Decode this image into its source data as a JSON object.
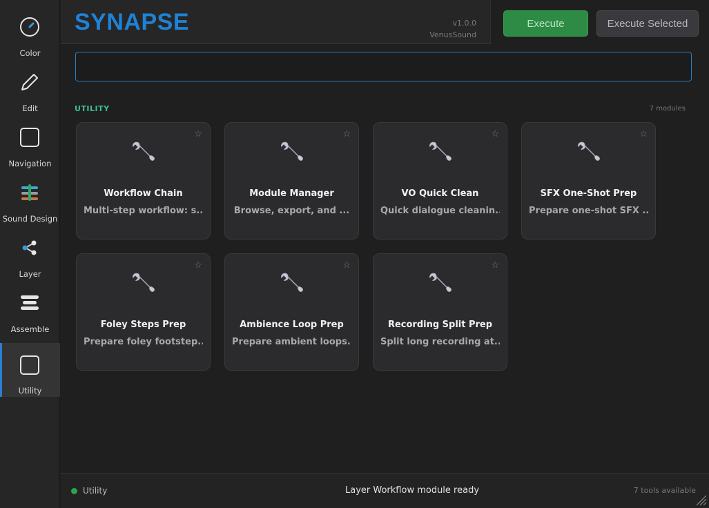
{
  "sidebar": {
    "items": [
      {
        "label": "Color",
        "icon": "gauge-icon"
      },
      {
        "label": "Edit",
        "icon": "pencil-icon"
      },
      {
        "label": "Navigation",
        "icon": "square-icon"
      },
      {
        "label": "Sound Design",
        "icon": "sliders-icon"
      },
      {
        "label": "Layer",
        "icon": "share-icon"
      },
      {
        "label": "Assemble",
        "icon": "stack-icon"
      },
      {
        "label": "Utility",
        "icon": "square-icon",
        "active": true
      }
    ]
  },
  "header": {
    "brand": "SYNAPSE",
    "version": "v1.0.0",
    "vendor": "VenusSound"
  },
  "toolbar": {
    "execute_label": "Execute",
    "execute_selected_label": "Execute Selected"
  },
  "search": {
    "value": "",
    "placeholder": ""
  },
  "section": {
    "title": "UTILITY",
    "count": "7 modules"
  },
  "modules": [
    {
      "name": "Workflow Chain",
      "desc": "Multi-step workflow: s...",
      "icon": "wrench-icon",
      "favorite_icon": "star-icon"
    },
    {
      "name": "Module Manager",
      "desc": "Browse, export, and ...",
      "icon": "wrench-icon",
      "favorite_icon": "star-icon"
    },
    {
      "name": "VO Quick Clean",
      "desc": "Quick dialogue cleanin...",
      "icon": "wrench-icon",
      "favorite_icon": "star-icon"
    },
    {
      "name": "SFX One-Shot Prep",
      "desc": "Prepare one-shot SFX ...",
      "icon": "wrench-icon",
      "favorite_icon": "star-icon"
    },
    {
      "name": "Foley Steps Prep",
      "desc": "Prepare foley footstep...",
      "icon": "wrench-icon",
      "favorite_icon": "star-icon"
    },
    {
      "name": "Ambience Loop Prep",
      "desc": "Prepare ambient loops...",
      "icon": "wrench-icon",
      "favorite_icon": "star-icon"
    },
    {
      "name": "Recording Split Prep",
      "desc": "Split long recording at...",
      "icon": "wrench-icon",
      "favorite_icon": "star-icon"
    }
  ],
  "status": {
    "module": "Utility",
    "message": "Layer Workflow module ready",
    "tools": "7 tools available",
    "indicator_color": "#2ea44f"
  },
  "colors": {
    "accent": "#1e82d6",
    "execute": "#2e8b45",
    "section": "#3fbf8f"
  }
}
